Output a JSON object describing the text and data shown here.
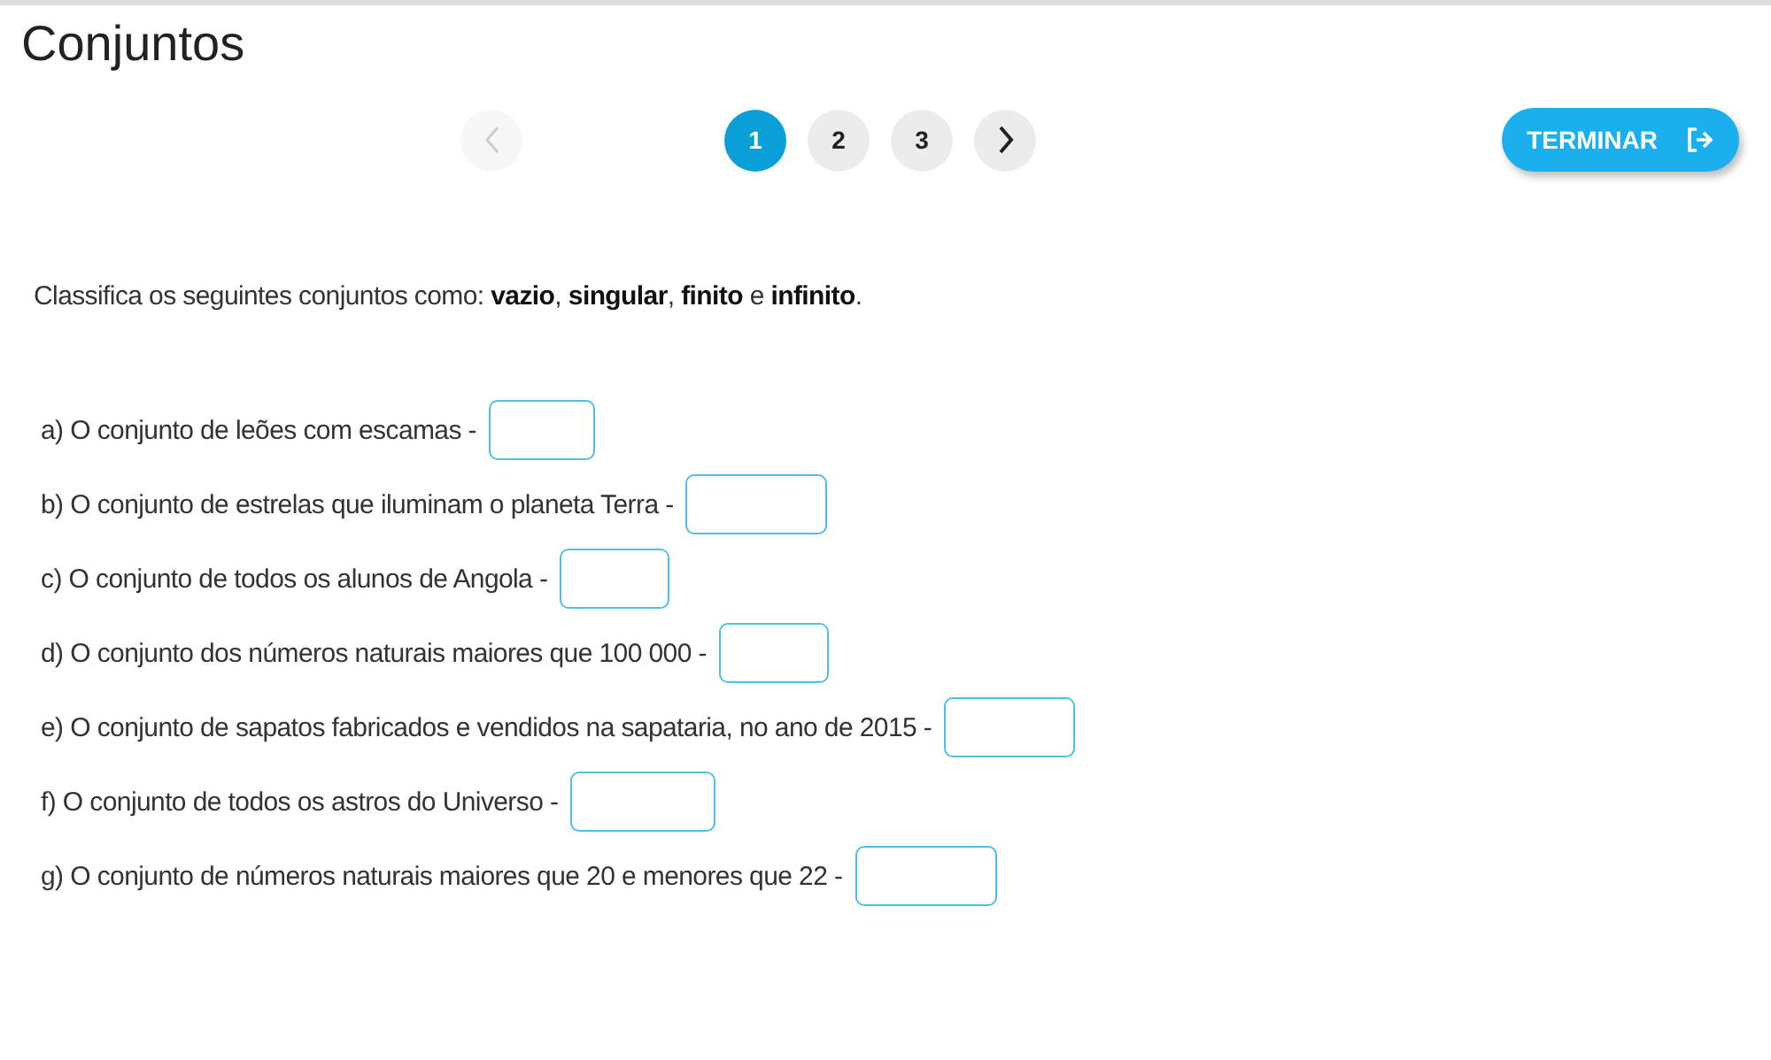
{
  "title": "Conjuntos",
  "pager": {
    "prev_disabled": true,
    "pages": [
      {
        "label": "1",
        "selected": true
      },
      {
        "label": "2",
        "selected": false
      },
      {
        "label": "3",
        "selected": false
      }
    ],
    "next_disabled": false
  },
  "finish_button": {
    "label": "TERMINAR"
  },
  "instruction": "Classifica os seguintes conjuntos como: **vazio**, **singular**, **finito** e **infinito**.",
  "questions": [
    {
      "text": "a) O conjunto de leões com escamas -"
    },
    {
      "text": "b) O conjunto de estrelas que iluminam o planeta Terra -"
    },
    {
      "text": "c) O conjunto de todos os alunos de Angola -"
    },
    {
      "text": "d) O conjunto dos números naturais maiores que 100 000 -"
    },
    {
      "text": "e) O conjunto de sapatos fabricados e vendidos na sapataria, no ano de 2015 -"
    },
    {
      "text": "f) O conjunto de todos os astros do Universo -"
    },
    {
      "text": "g) O conjunto de números naturais maiores que 20 e menores que 22 -"
    }
  ]
}
